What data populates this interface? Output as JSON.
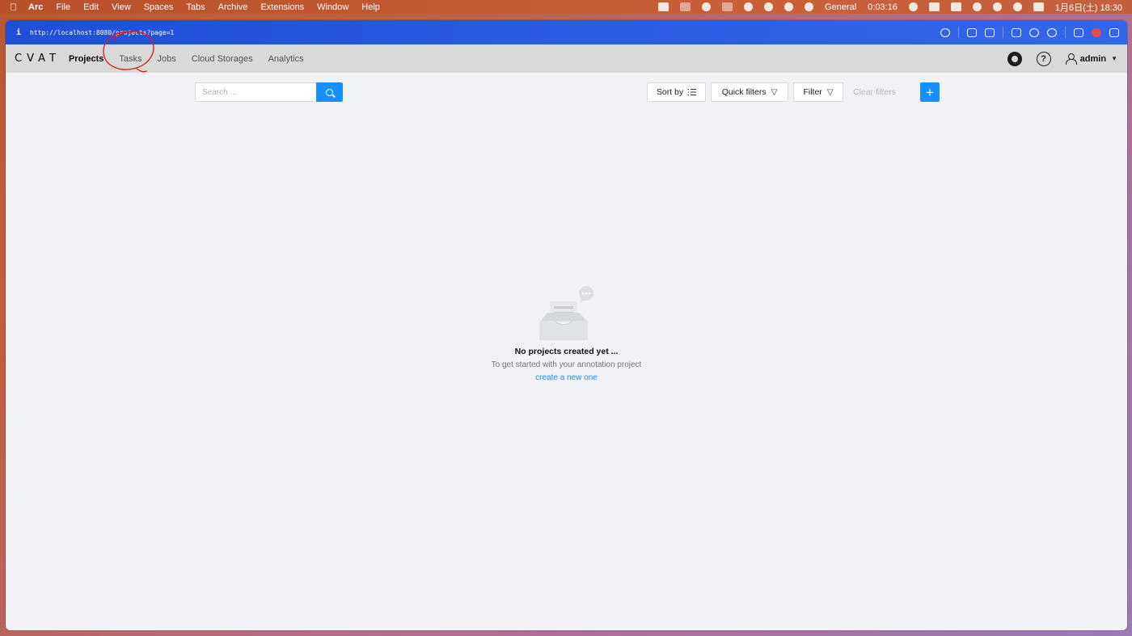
{
  "menubar": {
    "app_name": "Arc",
    "menus": [
      "File",
      "Edit",
      "View",
      "Spaces",
      "Tabs",
      "Archive",
      "Extensions",
      "Window",
      "Help"
    ],
    "status_label": "General",
    "timer": "0:03:16",
    "clock": "1月6日(土) 18:30"
  },
  "browser": {
    "info_glyph": "i",
    "url": "http://localhost:8080/projects?page=1"
  },
  "header": {
    "logo": "CVAT",
    "nav": [
      "Projects",
      "Tasks",
      "Jobs",
      "Cloud Storages",
      "Analytics"
    ],
    "active_nav": "Projects",
    "help_glyph": "?",
    "username": "admin"
  },
  "toolbar": {
    "search_placeholder": "Search ...",
    "sort_label": "Sort by",
    "quick_filters_label": "Quick filters",
    "filter_label": "Filter",
    "clear_filters_label": "Clear filters",
    "add_glyph": "+"
  },
  "empty_state": {
    "title": "No projects created yet ...",
    "subtitle": "To get started with your annotation project",
    "link": "create a new one"
  },
  "colors": {
    "accent": "#1890ff",
    "annotation_circle": "#e02020",
    "url_bar": "#2a5be3",
    "header_bg": "#d9d9d9"
  }
}
